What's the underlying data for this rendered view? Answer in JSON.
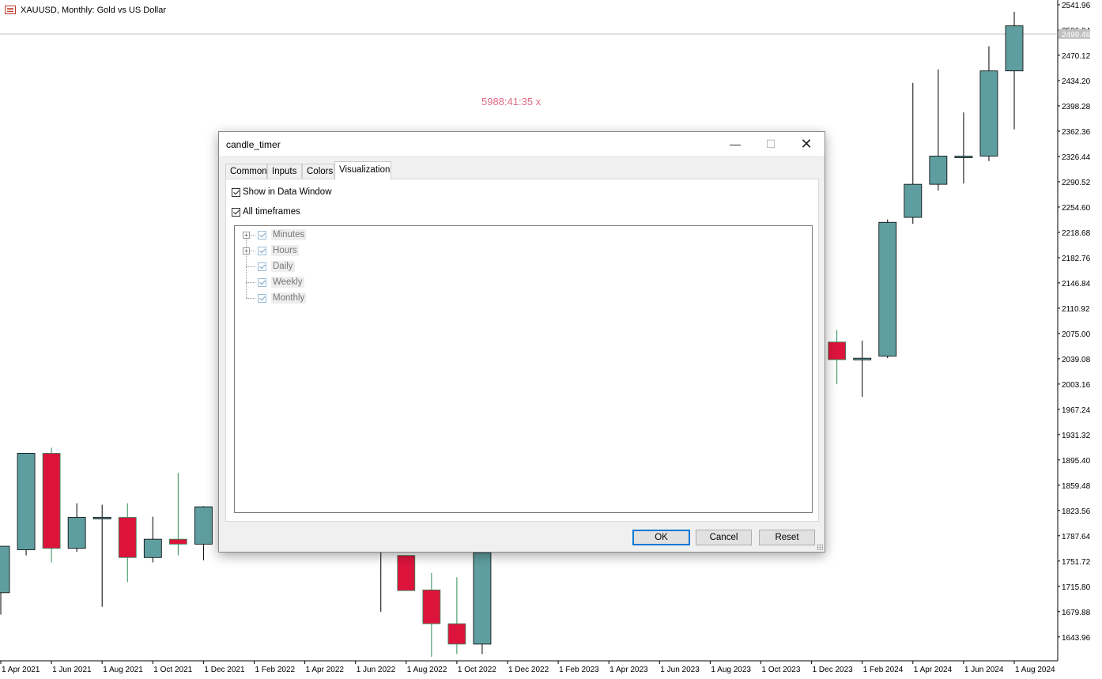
{
  "window": {
    "symbol_title": "XAUUSD, Monthly:  Gold vs US Dollar",
    "timer_text": "5988:41:35 x",
    "icon": "chart-window-icon"
  },
  "price_axis": {
    "current_price": "2499.46",
    "labels": [
      "2541.96",
      "2506.04",
      "2470.12",
      "2434.20",
      "2398.28",
      "2362.36",
      "2326.44",
      "2290.52",
      "2254.60",
      "2218.68",
      "2182.76",
      "2146.84",
      "2110.92",
      "2075.00",
      "2039.08",
      "2003.16",
      "1967.24",
      "1931.32",
      "1895.40",
      "1859.48",
      "1823.56",
      "1787.64",
      "1751.72",
      "1715.80",
      "1679.88",
      "1643.96"
    ]
  },
  "time_axis": {
    "labels": [
      "1 Apr 2021",
      "1 Jun 2021",
      "1 Aug 2021",
      "1 Oct 2021",
      "1 Dec 2021",
      "1 Feb 2022",
      "1 Apr 2022",
      "1 Jun 2022",
      "1 Aug 2022",
      "1 Oct 2022",
      "1 Dec 2022",
      "1 Feb 2023",
      "1 Apr 2023",
      "1 Jun 2023",
      "1 Aug 2023",
      "1 Oct 2023",
      "1 Dec 2023",
      "1 Feb 2024",
      "1 Apr 2024",
      "1 Jun 2024",
      "1 Aug 2024"
    ]
  },
  "colors": {
    "bull": "#5f9ea0",
    "bear": "#dc143c",
    "timer": "#e06a83"
  },
  "chart_data": {
    "type": "candlestick",
    "title": "XAUUSD, Monthly:  Gold vs US Dollar",
    "y_range": [
      1620,
      2545
    ],
    "candles": [
      {
        "t": "2021-03",
        "o": 1707,
        "h": 1773,
        "l": 1676,
        "c": 1773
      },
      {
        "t": "2021-04",
        "o": 1768,
        "h": 1845,
        "l": 1760,
        "c": 1905
      },
      {
        "t": "2021-05",
        "o": 1905,
        "h": 1913,
        "l": 1750,
        "c": 1770
      },
      {
        "t": "2021-06",
        "o": 1770,
        "h": 1834,
        "l": 1765,
        "c": 1814
      },
      {
        "t": "2021-07",
        "o": 1814,
        "h": 1832,
        "l": 1687,
        "c": 1814
      },
      {
        "t": "2021-08",
        "o": 1814,
        "h": 1834,
        "l": 1722,
        "c": 1757
      },
      {
        "t": "2021-09",
        "o": 1757,
        "h": 1815,
        "l": 1750,
        "c": 1783
      },
      {
        "t": "2021-10",
        "o": 1783,
        "h": 1877,
        "l": 1760,
        "c": 1776
      },
      {
        "t": "2021-11",
        "o": 1776,
        "h": 1830,
        "l": 1753,
        "c": 1829
      }
    ],
    "candles_late": [
      {
        "t": "2022-06",
        "o": 1807,
        "h": 1808,
        "l": 1680,
        "c": 1807
      },
      {
        "t": "2022-07",
        "o": 1760,
        "h": 1760,
        "l": 1710,
        "c": 1710
      },
      {
        "t": "2022-08",
        "o": 1711,
        "h": 1735,
        "l": 1616,
        "c": 1663
      },
      {
        "t": "2022-09",
        "o": 1663,
        "h": 1729,
        "l": 1620,
        "c": 1634
      },
      {
        "t": "2022-10",
        "o": 1634,
        "h": 1764,
        "l": 1620,
        "c": 1764
      },
      {
        "t": "2023-12",
        "o": 2063,
        "h": 2080,
        "l": 2003,
        "c": 2038
      },
      {
        "t": "2024-01",
        "o": 2038,
        "h": 2065,
        "l": 1985,
        "c": 2040
      },
      {
        "t": "2024-02",
        "o": 2043,
        "h": 2237,
        "l": 2040,
        "c": 2233
      },
      {
        "t": "2024-03",
        "o": 2240,
        "h": 2431,
        "l": 2231,
        "c": 2287
      },
      {
        "t": "2024-04",
        "o": 2287,
        "h": 2450,
        "l": 2278,
        "c": 2327
      },
      {
        "t": "2024-05",
        "o": 2327,
        "h": 2389,
        "l": 2288,
        "c": 2327
      },
      {
        "t": "2024-06",
        "o": 2327,
        "h": 2483,
        "l": 2320,
        "c": 2448
      },
      {
        "t": "2024-07",
        "o": 2448,
        "h": 2532,
        "l": 2365,
        "c": 2512
      }
    ]
  },
  "dialog": {
    "title": "candle_timer",
    "tabs": [
      "Common",
      "Inputs",
      "Colors",
      "Visualization"
    ],
    "active_tab": "Visualization",
    "show_in_data_window": "Show in Data Window",
    "all_timeframes": "All timeframes",
    "tree": [
      "Minutes",
      "Hours",
      "Daily",
      "Weekly",
      "Monthly"
    ],
    "buttons": {
      "ok": "OK",
      "cancel": "Cancel",
      "reset": "Reset"
    }
  }
}
